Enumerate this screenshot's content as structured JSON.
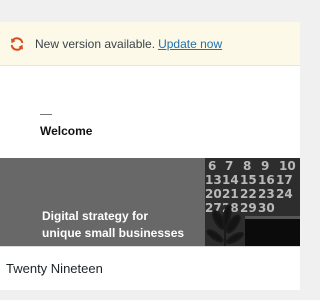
{
  "notice": {
    "icon": "update-icon",
    "message": "New version available.",
    "link_label": "Update now",
    "color": "#d54e21"
  },
  "preview": {
    "heading": "Welcome",
    "hero_line1": "Digital strategy for",
    "hero_line2": "unique small businesses",
    "hero_color": "#686868"
  },
  "theme": {
    "name": "Twenty Nineteen"
  }
}
